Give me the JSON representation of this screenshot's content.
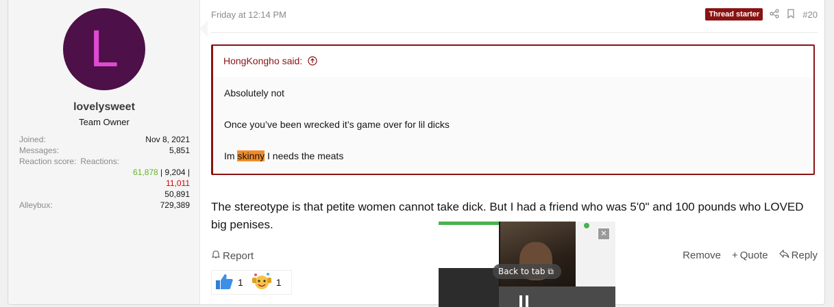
{
  "user": {
    "avatar_letter": "L",
    "name": "lovelysweet",
    "title": "Team Owner",
    "stats": [
      {
        "label": "Joined:",
        "value": "Nov 8, 2021"
      },
      {
        "label": "Messages:",
        "value": "5,851"
      }
    ],
    "reaction_score_label": "Reaction score:",
    "reactions_label": "Reactions:",
    "reaction_positive": "61,878",
    "sep1": " | ",
    "reaction_neutral": "9,204",
    "sep2": " |",
    "reaction_negative": "11,011",
    "reaction_total": "50,891",
    "alleybux_label": "Alleybux:",
    "alleybux_value": "729,389"
  },
  "post": {
    "date": "Friday at 12:14 PM",
    "badge": "Thread starter",
    "number": "#20",
    "quote": {
      "author": "HongKongho said:",
      "lines": [
        "Absolutely not",
        "Once you’ve been wrecked it’s game over for lil dicks"
      ],
      "last_prefix": "Im ",
      "last_highlight": "skinny",
      "last_suffix": " I needs the meats"
    },
    "content": "The stereotype is that petite women cannot take dick. But I had a friend who was 5'0\" and 100 pounds who LOVED big penises.",
    "report": "Report",
    "remove": "Remove",
    "quote_btn": "Quote",
    "reply": "Reply",
    "reactions": [
      {
        "icon": "thumbs-up-icon",
        "count": "1"
      },
      {
        "icon": "cheer-emoji-icon",
        "count": "1"
      }
    ]
  },
  "pip": {
    "back_to_tab": "Back to tab"
  }
}
